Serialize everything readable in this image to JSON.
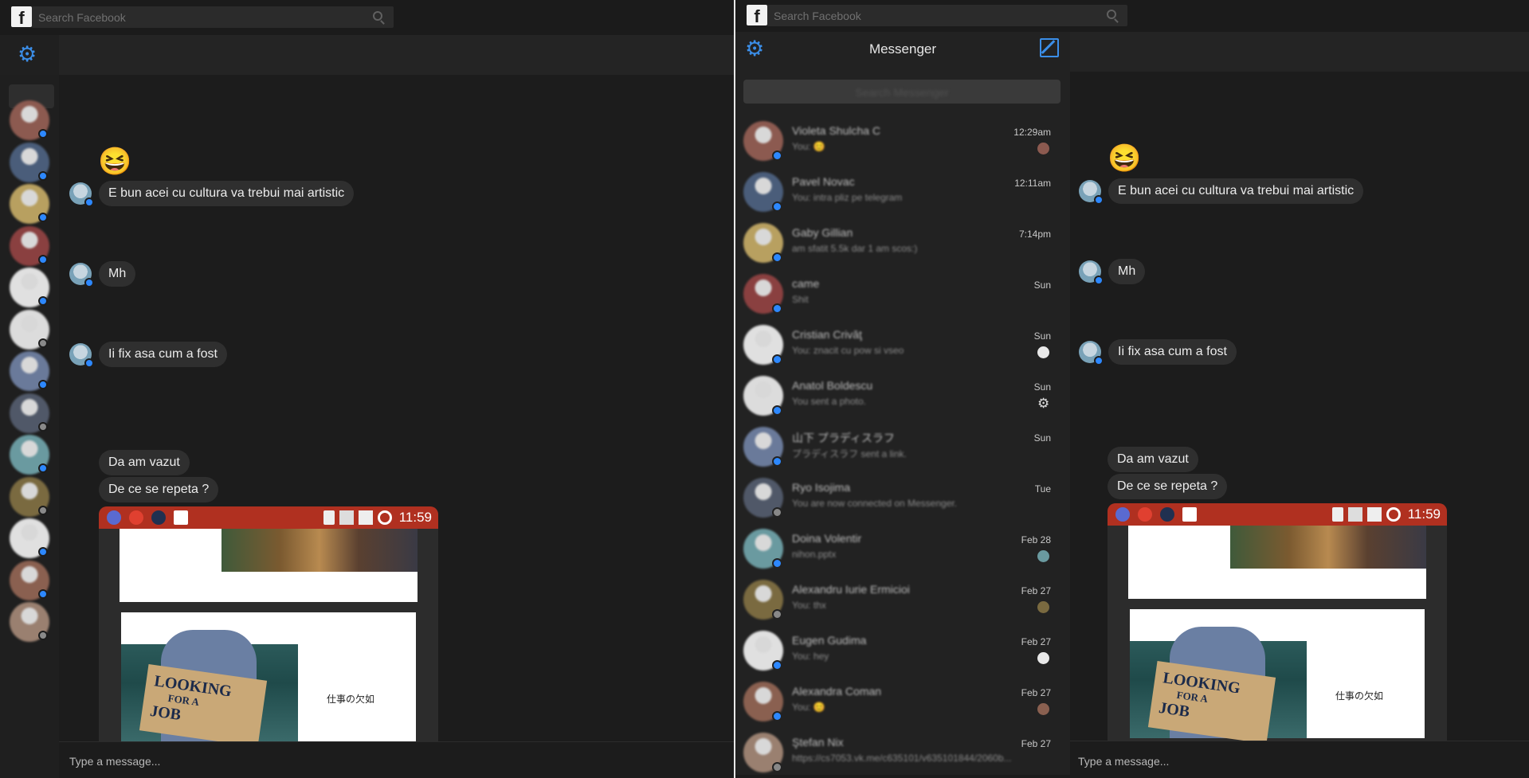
{
  "left": {
    "search_placeholder": "Search Facebook",
    "messages": {
      "emoji": "😆",
      "m1": "E bun acei cu cultura va trebui mai artistic",
      "m2": "Mh",
      "m3": "Ii fix asa cum a fost",
      "m4": "Da am vazut",
      "m5": "De ce se repeta ?"
    },
    "attachment": {
      "status_time": "11:59",
      "sign_text_1": "LOOKING",
      "sign_text_2": "FOR A",
      "sign_text_3": "JOB",
      "caption": "仕事の欠如"
    },
    "composer_placeholder": "Type a message..."
  },
  "right": {
    "search_placeholder": "Search Facebook",
    "panel_title": "Messenger",
    "messenger_search_placeholder": "Search Messenger",
    "threads": [
      {
        "name": "Violeta Shulcha C",
        "snippet": "You: 😊",
        "time": "12:29am",
        "av": "#8c5a50"
      },
      {
        "name": "Pavel Novac",
        "snippet": "You: intra pliz pe telegram",
        "time": "12:11am",
        "av": "#4a5d7a"
      },
      {
        "name": "Gaby Gillian",
        "snippet": "am sfatit 5.5k dar 1 am scos:)",
        "time": "7:14pm",
        "av": "#b8a060"
      },
      {
        "name": "came",
        "snippet": "Shit",
        "time": "Sun",
        "av": "#8a4040"
      },
      {
        "name": "Cristian Crivăţ",
        "snippet": "You: znacit cu pow si vseo",
        "time": "Sun",
        "av": "#e0e0e0"
      },
      {
        "name": "Anatol Boldescu",
        "snippet": "You sent a photo.",
        "time": "Sun",
        "av": "#dcdcdc"
      },
      {
        "name": "山下 プラディスラフ",
        "snippet": "プラディスラフ sent a link.",
        "time": "Sun",
        "av": "#6a7a9a"
      },
      {
        "name": "Ryo Isojima",
        "snippet": "You are now connected on Messenger.",
        "time": "Tue",
        "av": "#505868"
      },
      {
        "name": "Doina Volentir",
        "snippet": "nihon.pptx",
        "time": "Feb 28",
        "av": "#6a9aa0"
      },
      {
        "name": "Alexandru Iurie Ermicioi",
        "snippet": "You: thx",
        "time": "Feb 27",
        "av": "#7a6a40"
      },
      {
        "name": "Eugen Gudima",
        "snippet": "You: hey",
        "time": "Feb 27",
        "av": "#e0e0e0"
      },
      {
        "name": "Alexandra Coman",
        "snippet": "You: 😊",
        "time": "Feb 27",
        "av": "#8a6050"
      },
      {
        "name": "Ştefan Nix",
        "snippet": "https://cs7053.vk.me/c635101/v635101844/2060b...",
        "time": "Feb 27",
        "av": "#9a8070"
      }
    ],
    "messages": {
      "emoji": "😆",
      "m1": "E bun acei cu cultura va trebui mai artistic",
      "m2": "Mh",
      "m3": "Ii fix asa cum a fost",
      "m4": "Da am vazut",
      "m5": "De ce se repeta ?"
    },
    "attachment": {
      "status_time": "11:59",
      "sign_text_1": "LOOKING",
      "sign_text_2": "FOR A",
      "sign_text_3": "JOB",
      "caption": "仕事の欠如"
    },
    "composer_placeholder": "Type a message..."
  },
  "icons": {
    "settings": "gear-icon",
    "compose": "compose-icon",
    "search": "search-icon"
  },
  "colors": {
    "accent": "#3b8ee8",
    "bubble": "#2f2f2f",
    "background": "#1c1c1c",
    "android_status_bar": "#b03020"
  }
}
